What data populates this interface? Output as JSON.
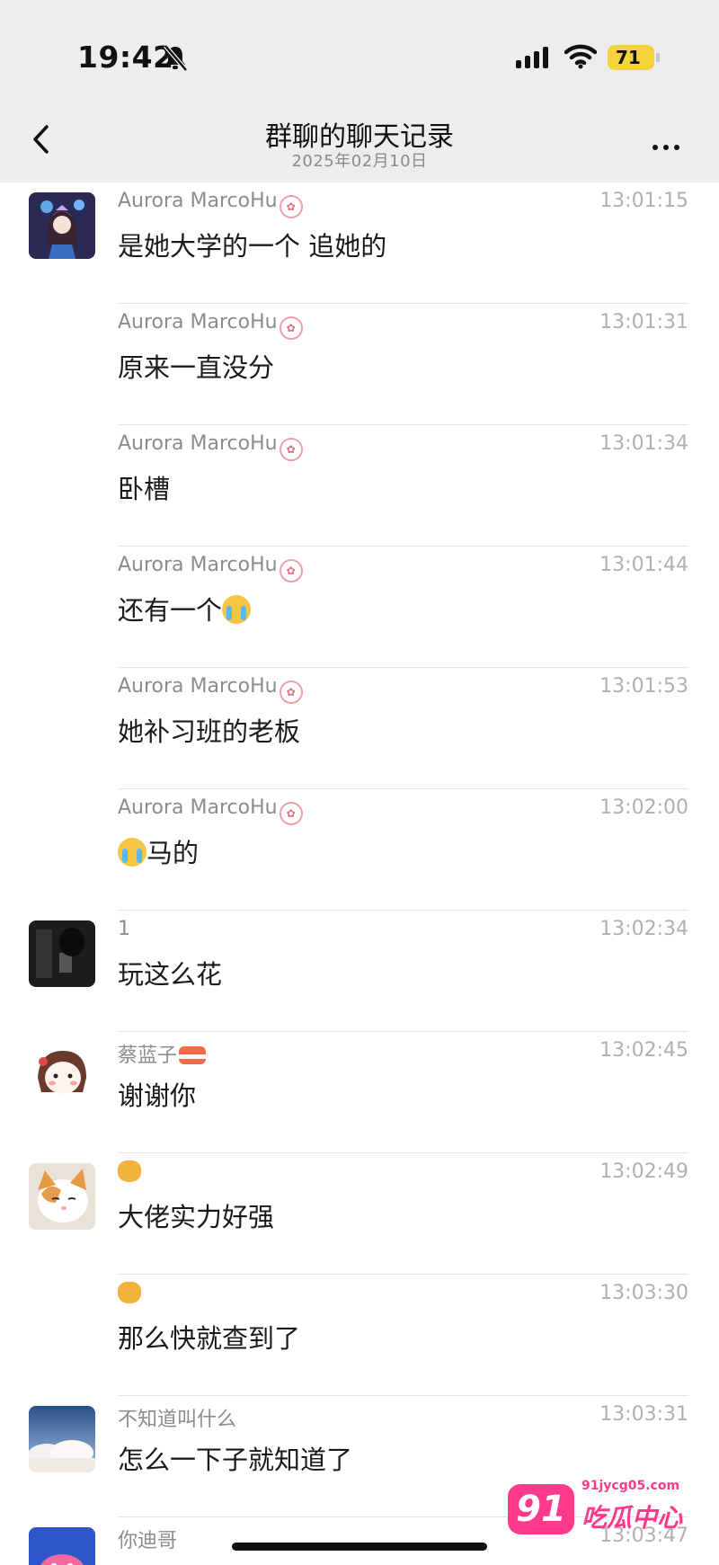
{
  "status_bar": {
    "time": "19:42",
    "battery": "71"
  },
  "nav": {
    "title": "群聊的聊天记录",
    "subtitle": "2025年02月10日"
  },
  "messages": [
    {
      "sender": "Aurora MarcoHu",
      "time": "13:01:15",
      "text": "是她大学的一个 追她的",
      "avatar": "anime-girl-avatar"
    },
    {
      "sender": "Aurora MarcoHu",
      "time": "13:01:31",
      "text": "原来一直没分"
    },
    {
      "sender": "Aurora MarcoHu",
      "time": "13:01:34",
      "text": "卧槽"
    },
    {
      "sender": "Aurora MarcoHu",
      "time": "13:01:44",
      "text": "还有一个"
    },
    {
      "sender": "Aurora MarcoHu",
      "time": "13:01:53",
      "text": "她补习班的老板"
    },
    {
      "sender": "Aurora MarcoHu",
      "time": "13:02:00",
      "text": "马的"
    },
    {
      "sender": "1",
      "time": "13:02:34",
      "text": "玩这么花",
      "avatar": "dark-photo-avatar"
    },
    {
      "sender": "蔡蓝子",
      "time": "13:02:45",
      "text": "谢谢你",
      "avatar": "cartoon-girl-avatar"
    },
    {
      "sender": "",
      "time": "13:02:49",
      "text": "大佬实力好强",
      "avatar": "cat-avatar"
    },
    {
      "sender": "",
      "time": "13:03:30",
      "text": "那么快就查到了"
    },
    {
      "sender": "不知道叫什么",
      "time": "13:03:31",
      "text": "怎么一下子就知道了",
      "avatar": "sky-clouds-avatar"
    },
    {
      "sender": "你迪哥",
      "time": "13:03:47",
      "text": "",
      "avatar": "pink-creature-avatar"
    }
  ],
  "watermark": {
    "logo": "91",
    "domain": "91jycg05.com",
    "text": "吃瓜中心"
  },
  "colors": {
    "header_bg": "#ededed",
    "battery": "#f3d23a",
    "watermark": "#ff3a8a"
  }
}
